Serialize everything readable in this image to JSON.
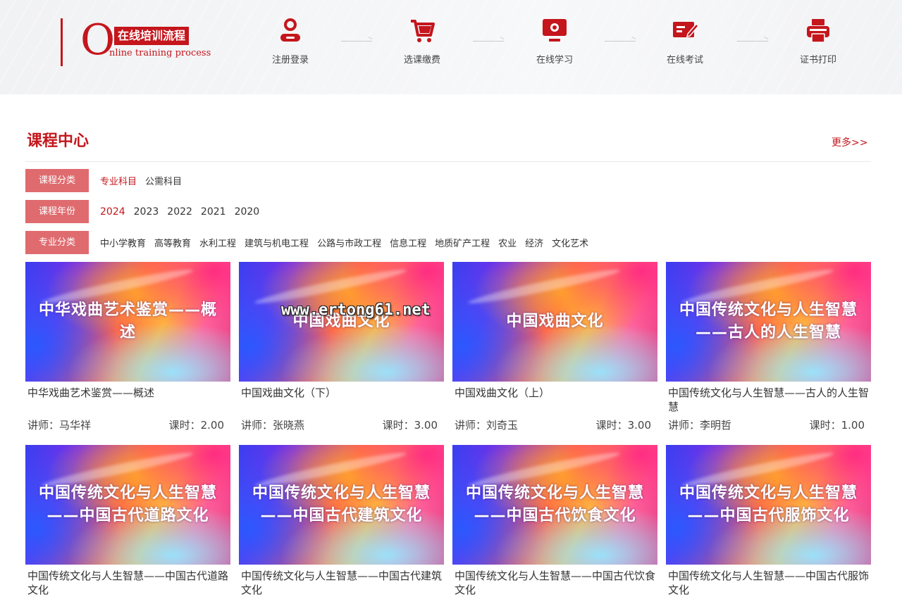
{
  "process": {
    "logo_letter": "O",
    "logo_cn": "在线培训流程",
    "logo_en": "nline training process",
    "steps": [
      {
        "label": "注册登录",
        "icon": "user-icon"
      },
      {
        "label": "选课缴费",
        "icon": "cart-icon"
      },
      {
        "label": "在线学习",
        "icon": "monitor-icon"
      },
      {
        "label": "在线考试",
        "icon": "exam-icon"
      },
      {
        "label": "证书打印",
        "icon": "printer-icon"
      }
    ]
  },
  "course_center": {
    "title": "课程中心",
    "more": "更多>>",
    "filters": {
      "category": {
        "label": "课程分类",
        "options": [
          "专业科目",
          "公需科目"
        ],
        "selected": "专业科目"
      },
      "year": {
        "label": "课程年份",
        "options": [
          "2024",
          "2023",
          "2022",
          "2021",
          "2020"
        ],
        "selected": "2024"
      },
      "major": {
        "label": "专业分类",
        "options": [
          "中小学教育",
          "高等教育",
          "水利工程",
          "建筑与机电工程",
          "公路与市政工程",
          "信息工程",
          "地质矿产工程",
          "农业",
          "经济",
          "文化艺术"
        ]
      }
    },
    "courses": [
      {
        "thumb_text": [
          "中华戏曲艺术鉴赏——概述"
        ],
        "name": "中华戏曲艺术鉴赏——概述",
        "teacher": "讲师：马华祥",
        "hours": "课时：2.00"
      },
      {
        "thumb_text": [
          "中国戏曲文化"
        ],
        "name": "中国戏曲文化（下）",
        "teacher": "讲师：张晓燕",
        "hours": "课时：3.00"
      },
      {
        "thumb_text": [
          "中国戏曲文化"
        ],
        "name": "中国戏曲文化（上）",
        "teacher": "讲师：刘奇玉",
        "hours": "课时：3.00"
      },
      {
        "thumb_text": [
          "中国传统文化与人生智慧",
          "——古人的人生智慧"
        ],
        "name": "中国传统文化与人生智慧——古人的人生智慧",
        "teacher": "讲师：李明哲",
        "hours": "课时：1.00"
      },
      {
        "thumb_text": [
          "中国传统文化与人生智慧",
          "——中国古代道路文化"
        ],
        "name": "中国传统文化与人生智慧——中国古代道路文化",
        "teacher": "",
        "hours": ""
      },
      {
        "thumb_text": [
          "中国传统文化与人生智慧",
          "——中国古代建筑文化"
        ],
        "name": "中国传统文化与人生智慧——中国古代建筑文化",
        "teacher": "",
        "hours": ""
      },
      {
        "thumb_text": [
          "中国传统文化与人生智慧",
          "——中国古代饮食文化"
        ],
        "name": "中国传统文化与人生智慧——中国古代饮食文化",
        "teacher": "",
        "hours": ""
      },
      {
        "thumb_text": [
          "中国传统文化与人生智慧",
          "——中国古代服饰文化"
        ],
        "name": "中国传统文化与人生智慧——中国古代服饰文化",
        "teacher": "",
        "hours": ""
      }
    ]
  },
  "watermark": "www.ertong61.net",
  "colors": {
    "brand_red": "#c4161c",
    "filter_label_bg": "#df6b6f"
  }
}
